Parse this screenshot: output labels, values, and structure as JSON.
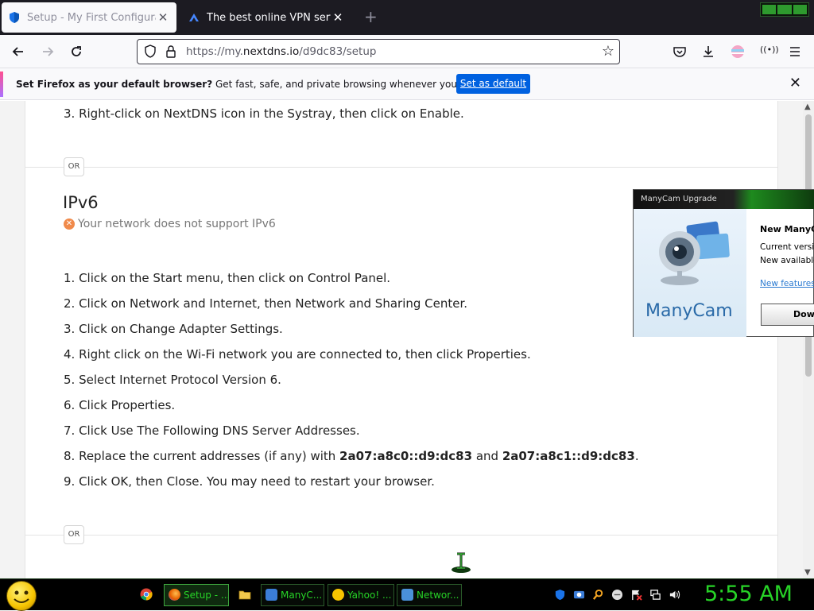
{
  "browser": {
    "tabs": [
      {
        "title": "Setup - My First Configuration",
        "icon": "nextdns-shield-icon",
        "active": true
      },
      {
        "title": "The best online VPN service for",
        "icon": "nordvpn-icon",
        "active": false
      }
    ],
    "url_prefix": "https://my.",
    "url_domain": "nextdns.io",
    "url_path": "/d9dc83/setup"
  },
  "notice": {
    "lead": "Set Firefox as your default browser?",
    "text": " Get fast, safe, and private browsing whenever you use the web.",
    "button": "Set as default"
  },
  "page": {
    "top_step": "3. Right-click on NextDNS icon in the Systray, then click on Enable.",
    "or_label": "OR",
    "ipv6_title": "IPv6",
    "ipv6_note": "Your network does not support IPv6",
    "steps": [
      "1. Click on the Start menu, then click on Control Panel.",
      "2. Click on Network and Internet, then Network and Sharing Center.",
      "3. Click on Change Adapter Settings.",
      "4. Right click on the Wi-Fi network you are connected to, then click Properties.",
      "5. Select Internet Protocol Version 6.",
      "6. Click Properties.",
      "7. Click Use The Following DNS Server Addresses."
    ],
    "step8_prefix": "8. Replace the current addresses (if any) with ",
    "step8_addr1": "2a07:a8c0::d9:dc83",
    "step8_and": " and ",
    "step8_addr2": "2a07:a8c1::d9:dc83",
    "step8_suffix": ".",
    "step9": "9. Click OK, then Close. You may need to restart your browser."
  },
  "manycam": {
    "title": "ManyCam Upgrade",
    "logo": "ManyCam",
    "heading": "New ManyCa",
    "current": "Current versio",
    "new_available": "New available",
    "features_link": "New features",
    "download_button": "Dow"
  },
  "taskbar": {
    "buttons": [
      {
        "label": "Setup - ...",
        "icon": "firefox-icon",
        "color": "#e66000",
        "active": true
      },
      {
        "label": "ManyC...",
        "icon": "manycam-icon",
        "color": "#3b7dd8",
        "active": false
      },
      {
        "label": "Yahoo! ...",
        "icon": "yahoo-messenger-icon",
        "color": "#f6c400",
        "active": false
      },
      {
        "label": "Networ...",
        "icon": "network-icon",
        "color": "#4a90d9",
        "active": false
      }
    ],
    "clock": "5:55 AM"
  }
}
